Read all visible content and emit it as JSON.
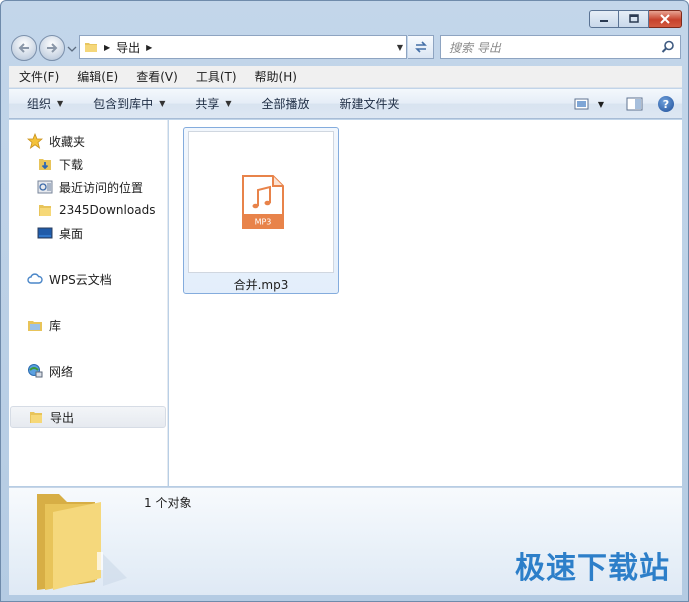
{
  "window": {
    "caption_buttons": [
      "minimize",
      "maximize",
      "close"
    ]
  },
  "address": {
    "path": [
      "导出"
    ],
    "search_placeholder": "搜索 导出"
  },
  "menu": {
    "items": [
      "文件(F)",
      "编辑(E)",
      "查看(V)",
      "工具(T)",
      "帮助(H)"
    ]
  },
  "toolbar": {
    "organize": "组织",
    "include_in_library": "包含到库中",
    "share": "共享",
    "play_all": "全部播放",
    "new_folder": "新建文件夹"
  },
  "navigation": {
    "favorites": {
      "label": "收藏夹",
      "items": [
        "下载",
        "最近访问的位置",
        "2345Downloads",
        "桌面"
      ]
    },
    "wps_cloud": "WPS云文档",
    "library": "库",
    "network": "网络",
    "current_folder": "导出"
  },
  "files": [
    {
      "name": "合并.mp3",
      "badge": "MP3",
      "icon": "mp3-file-icon"
    }
  ],
  "details": {
    "count": "1 个对象"
  },
  "watermark": "极速下载站",
  "colors": {
    "mp3_accent": "#e8834a",
    "selection_border": "#84acdd",
    "watermark": "#2d7fc9"
  }
}
